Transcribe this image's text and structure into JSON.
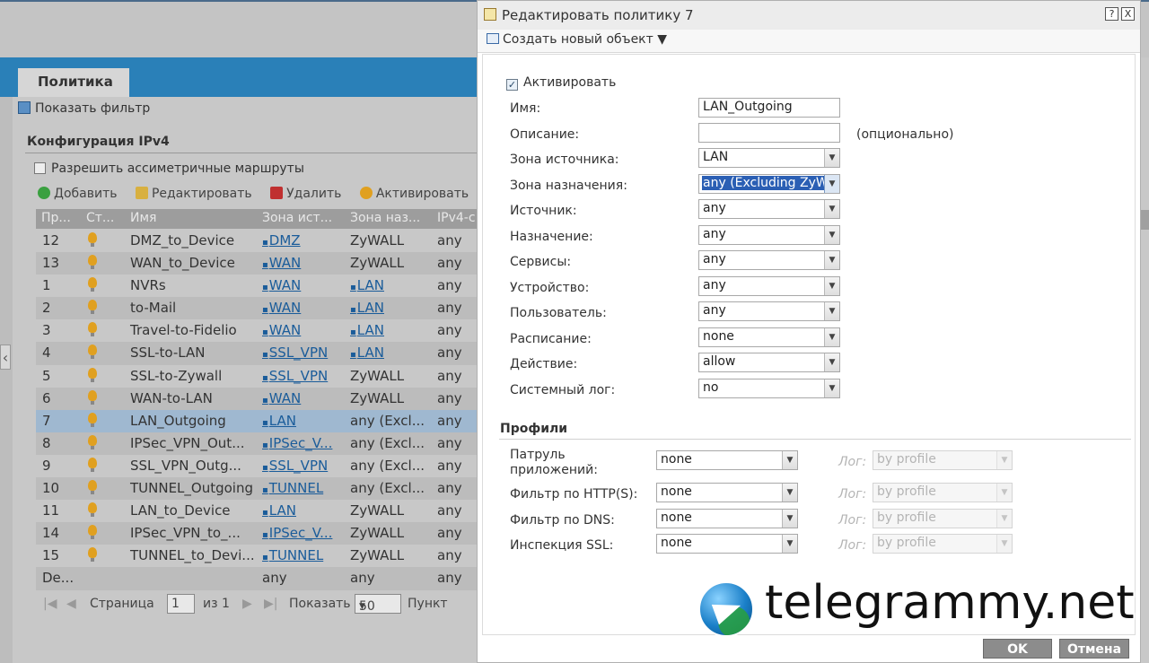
{
  "background": {
    "tab_policy": "Политика",
    "show_filter": "Показать фильтр",
    "ipv4_title": "Конфигурация IPv4",
    "asymmetric_routes": "Разрешить ассиметричные маршруты",
    "toolbar": {
      "add": "Добавить",
      "edit": "Редактировать",
      "delete": "Удалить",
      "activate": "Активировать"
    },
    "columns": [
      "Пр...",
      "Ст...",
      "Имя",
      "Зона ист...",
      "Зона наз...",
      "IPv4-с..."
    ],
    "rows": [
      {
        "priority": "12",
        "name": "DMZ_to_Device",
        "from": "DMZ",
        "from_link": true,
        "to": "ZyWALL",
        "to_link": false,
        "src": "any"
      },
      {
        "priority": "13",
        "name": "WAN_to_Device",
        "from": "WAN",
        "from_link": true,
        "to": "ZyWALL",
        "to_link": false,
        "src": "any"
      },
      {
        "priority": "1",
        "name": "NVRs",
        "from": "WAN",
        "from_link": true,
        "to": "LAN",
        "to_link": true,
        "src": "any"
      },
      {
        "priority": "2",
        "name": "to-Mail",
        "from": "WAN",
        "from_link": true,
        "to": "LAN",
        "to_link": true,
        "src": "any"
      },
      {
        "priority": "3",
        "name": "Travel-to-Fidelio",
        "from": "WAN",
        "from_link": true,
        "to": "LAN",
        "to_link": true,
        "src": "any"
      },
      {
        "priority": "4",
        "name": "SSL-to-LAN",
        "from": "SSL_VPN",
        "from_link": true,
        "to": "LAN",
        "to_link": true,
        "src": "any"
      },
      {
        "priority": "5",
        "name": "SSL-to-Zywall",
        "from": "SSL_VPN",
        "from_link": true,
        "to": "ZyWALL",
        "to_link": false,
        "src": "any"
      },
      {
        "priority": "6",
        "name": "WAN-to-LAN",
        "from": "WAN",
        "from_link": true,
        "to": "ZyWALL",
        "to_link": false,
        "src": "any"
      },
      {
        "priority": "7",
        "name": "LAN_Outgoing",
        "from": "LAN",
        "from_link": true,
        "to": "any (Excl...",
        "to_link": false,
        "src": "any",
        "selected": true
      },
      {
        "priority": "8",
        "name": "IPSec_VPN_Out...",
        "from": "IPSec_V...",
        "from_link": true,
        "to": "any (Excl...",
        "to_link": false,
        "src": "any"
      },
      {
        "priority": "9",
        "name": "SSL_VPN_Outg...",
        "from": "SSL_VPN",
        "from_link": true,
        "to": "any (Excl...",
        "to_link": false,
        "src": "any"
      },
      {
        "priority": "10",
        "name": "TUNNEL_Outgoing",
        "from": "TUNNEL",
        "from_link": true,
        "to": "any (Excl...",
        "to_link": false,
        "src": "any"
      },
      {
        "priority": "11",
        "name": "LAN_to_Device",
        "from": "LAN",
        "from_link": true,
        "to": "ZyWALL",
        "to_link": false,
        "src": "any"
      },
      {
        "priority": "14",
        "name": "IPSec_VPN_to_...",
        "from": "IPSec_V...",
        "from_link": true,
        "to": "ZyWALL",
        "to_link": false,
        "src": "any"
      },
      {
        "priority": "15",
        "name": "TUNNEL_to_Devi...",
        "from": "TUNNEL",
        "from_link": true,
        "to": "ZyWALL",
        "to_link": false,
        "src": "any"
      },
      {
        "priority": "De...",
        "name": "",
        "from": "any",
        "from_link": false,
        "to": "any",
        "to_link": false,
        "src": "any",
        "bulb": false
      }
    ],
    "pager": {
      "page_label": "Страница",
      "page_value": "1",
      "of_label": "из 1",
      "show_label": "Показать",
      "per_page": "50",
      "items_label": "Пункт"
    }
  },
  "dialog": {
    "title": "Редактировать политику 7",
    "help_btn": "?",
    "close_btn": "X",
    "create_object": "Создать новый объект",
    "activate_label": "Активировать",
    "name_label": "Имя:",
    "name_value": "LAN_Outgoing",
    "description_label": "Описание:",
    "description_value": "",
    "optional_hint": "(опционально)",
    "selects": [
      {
        "label": "Зона источника:",
        "value": "LAN"
      },
      {
        "label": "Зона назначения:",
        "value": "any (Excluding ZyWALL)",
        "focused": true
      },
      {
        "label": "Источник:",
        "value": "any"
      },
      {
        "label": "Назначение:",
        "value": "any"
      },
      {
        "label": "Сервисы:",
        "value": "any"
      },
      {
        "label": "Устройство:",
        "value": "any"
      },
      {
        "label": "Пользователь:",
        "value": "any"
      },
      {
        "label": "Расписание:",
        "value": "none"
      },
      {
        "label": "Действие:",
        "value": "allow"
      },
      {
        "label": "Системный лог:",
        "value": "no"
      }
    ],
    "profiles_title": "Профили",
    "profiles": [
      {
        "label_lines": [
          "Патруль",
          "приложений:"
        ],
        "value": "none",
        "log_label": "Лог:",
        "log_value": "by profile"
      },
      {
        "label_lines": [
          "Фильтр по HTTP(S):"
        ],
        "value": "none",
        "log_label": "Лог:",
        "log_value": "by profile"
      },
      {
        "label_lines": [
          "Фильтр по DNS:"
        ],
        "value": "none",
        "log_label": "Лог:",
        "log_value": "by profile"
      },
      {
        "label_lines": [
          "Инспекция SSL:"
        ],
        "value": "none",
        "log_label": "Лог:",
        "log_value": "by profile"
      }
    ],
    "ok": "OK",
    "cancel": "Отмена"
  },
  "watermark": {
    "text": "telegrammy.net"
  },
  "colors": {
    "accent_blue": "#2a80b8",
    "selected_row": "#9fb8d0",
    "focused_select": "#2b5fb4",
    "link": "#1a5c9a"
  }
}
